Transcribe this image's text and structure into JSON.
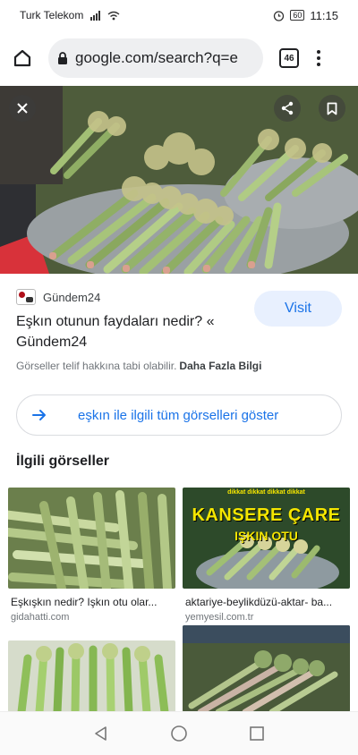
{
  "status_bar": {
    "carrier": "Turk Telekom",
    "battery": "60",
    "time": "11:15"
  },
  "browser": {
    "url": "google.com/search?q=e",
    "tab_count": "46"
  },
  "result": {
    "source_name": "Gündem24",
    "title": "Eşkın otunun faydaları nedir? « Gündem24",
    "visit_label": "Visit",
    "copyright_notice": "Görseller telif hakkına tabi olabilir.",
    "more_info_label": "Daha Fazla Bilgi"
  },
  "show_all_label": "eşkın ile ilgili tüm görselleri göster",
  "related": {
    "heading": "İlgili görseller",
    "items": [
      {
        "caption": "Eşkışkın nedir? Işkın otu olar...",
        "domain": "gidahatti.com"
      },
      {
        "caption": "aktariye-beylikdüzü-aktar- ba...",
        "domain": "yemyesil.com.tr",
        "overlay_line1": "KANSERE ÇARE",
        "overlay_line2": "IŞKIN OTU",
        "overlay_top": "dikkat dikkat dikkat dikkat"
      },
      {
        "caption": "",
        "domain": ""
      },
      {
        "caption": "",
        "domain": ""
      }
    ]
  },
  "colors": {
    "accent": "#1a73e8",
    "visit_bg": "#e8f0fe",
    "overlay_yellow": "#f5e600"
  }
}
